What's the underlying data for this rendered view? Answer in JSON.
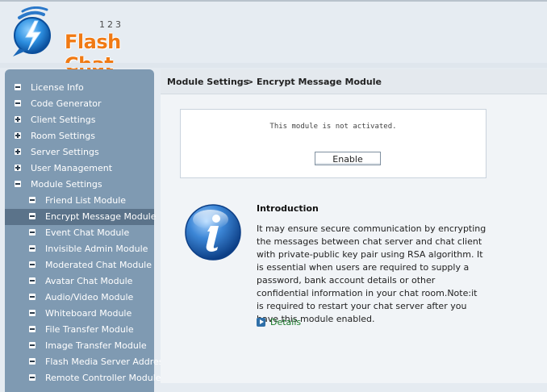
{
  "logo": {
    "numbers": "123",
    "text": "Flash Chat"
  },
  "breadcrumb": {
    "root": "Module Settings",
    "current": "> Encrypt Message Module"
  },
  "sidebar": {
    "items": [
      {
        "label": "License Info",
        "icon": "minus-icon",
        "level": 1
      },
      {
        "label": "Code Generator",
        "icon": "minus-icon",
        "level": 1
      },
      {
        "label": "Client Settings",
        "icon": "plus-icon",
        "level": 1
      },
      {
        "label": "Room Settings",
        "icon": "plus-icon",
        "level": 1
      },
      {
        "label": "Server Settings",
        "icon": "plus-icon",
        "level": 1
      },
      {
        "label": "User Management",
        "icon": "plus-icon",
        "level": 1
      },
      {
        "label": "Module Settings",
        "icon": "minus-icon",
        "level": 1
      },
      {
        "label": "Friend List Module",
        "icon": "minus-icon",
        "level": 2
      },
      {
        "label": "Encrypt Message Module",
        "icon": "minus-icon",
        "level": 2,
        "active": true
      },
      {
        "label": "Event Chat Module",
        "icon": "minus-icon",
        "level": 2
      },
      {
        "label": "Invisible Admin Module",
        "icon": "minus-icon",
        "level": 2
      },
      {
        "label": "Moderated Chat Module",
        "icon": "minus-icon",
        "level": 2
      },
      {
        "label": "Avatar Chat Module",
        "icon": "minus-icon",
        "level": 2
      },
      {
        "label": "Audio/Video Module",
        "icon": "minus-icon",
        "level": 2
      },
      {
        "label": "Whiteboard Module",
        "icon": "minus-icon",
        "level": 2
      },
      {
        "label": "File Transfer Module",
        "icon": "minus-icon",
        "level": 2
      },
      {
        "label": "Image Transfer Module",
        "icon": "minus-icon",
        "level": 2
      },
      {
        "label": "Flash Media Server Address",
        "icon": "minus-icon",
        "level": 2
      },
      {
        "label": "Remote Controller Module",
        "icon": "minus-icon",
        "level": 2
      }
    ]
  },
  "module": {
    "status_text": "This module is not activated.",
    "enable_label": "Enable"
  },
  "intro": {
    "title": "Introduction",
    "body": "It may ensure secure communication by encrypting the messages between chat server and chat client with private-public key pair using RSA algorithm. It is essential when users are required to supply a password, bank account details or other confidential information in your chat room.Note:it is required to restart your chat server after you have this module enabled.",
    "info_icon": "info-icon"
  },
  "details": {
    "label": "Details",
    "icon": "arrow-right-icon"
  },
  "colors": {
    "sidebar_bg": "#7f9ab2",
    "sidebar_active": "#5b738a",
    "brand_orange": "#f07a14",
    "link_green": "#1a7a2a"
  }
}
